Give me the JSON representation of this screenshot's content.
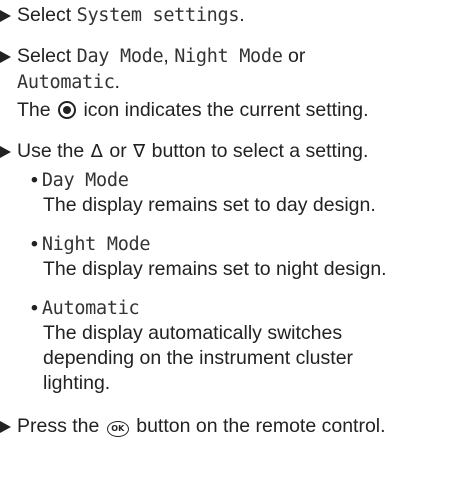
{
  "steps": {
    "step1": {
      "prefix": "Select",
      "target": "System settings",
      "suffix": "."
    },
    "step2": {
      "prefix": "Select",
      "option_day": "Day Mode",
      "sep": ",",
      "option_night": "Night Mode",
      "or_word": "or",
      "option_auto": "Automatic",
      "suffix": ".",
      "note_before": "The",
      "note_icon": "radio-selected-icon",
      "note_after": "icon indicates the current setting."
    },
    "step3": {
      "text_before": "Use the",
      "up_symbol": "Δ",
      "or_word": "or",
      "down_symbol": "∇",
      "text_after": "button to select a setting.",
      "options": [
        {
          "bullet": "•",
          "name": "Day Mode",
          "desc": [
            "The display remains set to day design."
          ]
        },
        {
          "bullet": "•",
          "name": "Night Mode",
          "desc": [
            "The display remains set to night design."
          ]
        },
        {
          "bullet": "•",
          "name": "Automatic",
          "desc": [
            "The display automatically switches",
            "depending on the instrument cluster",
            "lighting."
          ]
        }
      ]
    },
    "step4": {
      "text_before": "Press the",
      "ok_label": "OK",
      "text_after": "button on the remote control."
    }
  },
  "colors": {
    "text": "#222222",
    "background": "#ffffff"
  }
}
